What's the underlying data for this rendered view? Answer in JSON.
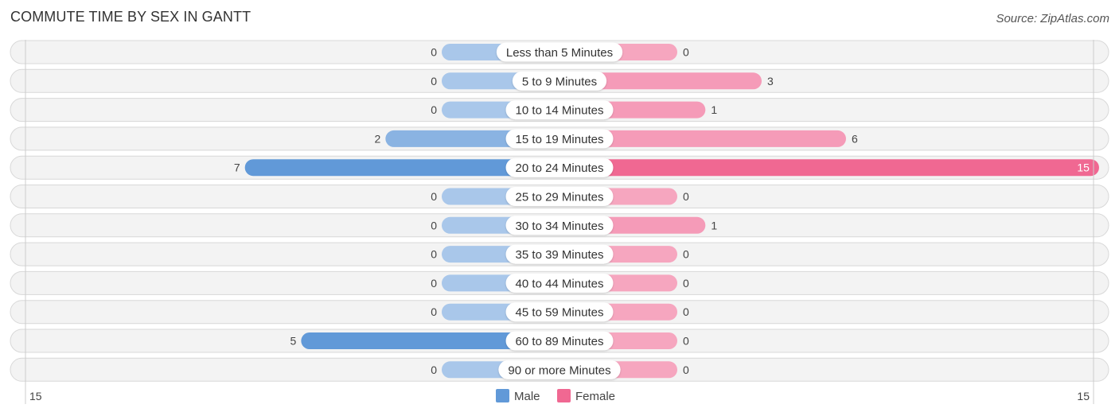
{
  "header": {
    "title": "COMMUTE TIME BY SEX IN GANTT",
    "source": "Source: ZipAtlas.com"
  },
  "colors": {
    "male_full": "#6199d8",
    "male_light": "#a9c7ea",
    "female_full": "#f06892",
    "female_light": "#f6a6bf",
    "row_bg": "#f3f3f3",
    "row_border": "#d8d8d8"
  },
  "chart_data": {
    "type": "bar",
    "orientation": "diverging-horizontal",
    "title": "COMMUTE TIME BY SEX IN GANTT",
    "categories": [
      "Less than 5 Minutes",
      "5 to 9 Minutes",
      "10 to 14 Minutes",
      "15 to 19 Minutes",
      "20 to 24 Minutes",
      "25 to 29 Minutes",
      "30 to 34 Minutes",
      "35 to 39 Minutes",
      "40 to 44 Minutes",
      "45 to 59 Minutes",
      "60 to 89 Minutes",
      "90 or more Minutes"
    ],
    "series": [
      {
        "name": "Male",
        "values": [
          0,
          0,
          0,
          2,
          7,
          0,
          0,
          0,
          0,
          0,
          5,
          0
        ]
      },
      {
        "name": "Female",
        "values": [
          0,
          3,
          1,
          6,
          15,
          0,
          1,
          0,
          0,
          0,
          0,
          0
        ]
      }
    ],
    "axis": {
      "left_label": "15",
      "right_label": "15",
      "range": [
        -15,
        15
      ]
    },
    "legend": {
      "position": "bottom-center",
      "entries": [
        "Male",
        "Female"
      ]
    }
  }
}
